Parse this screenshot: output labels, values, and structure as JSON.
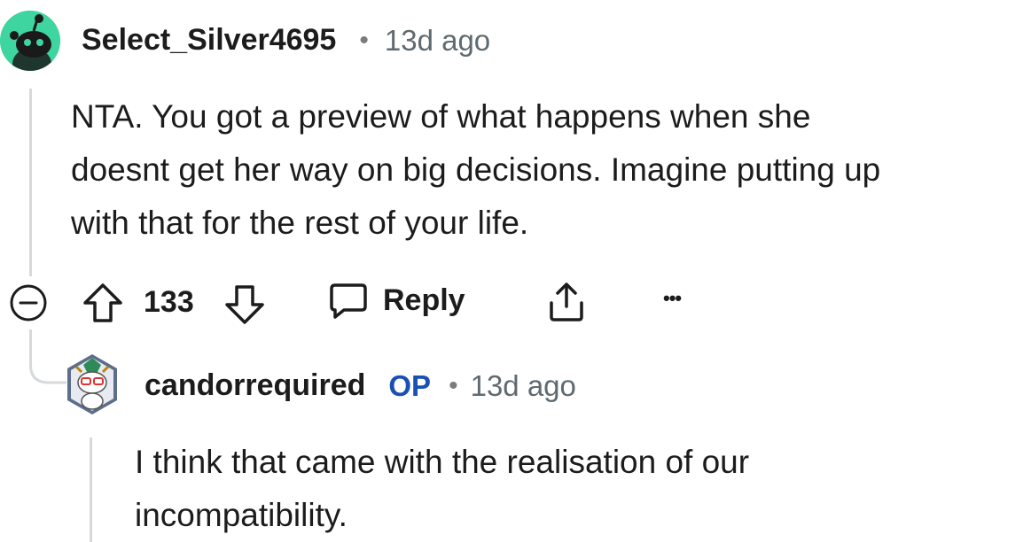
{
  "comment": {
    "author": "Select_Silver4695",
    "separator": "•",
    "time": "13d ago",
    "lines": [
      "NTA. You got a preview of what happens when she",
      "doesnt get her way on big decisions. Imagine putting up",
      "with that for the rest of your life."
    ],
    "avatar_color": "#3ed5a0"
  },
  "actions": {
    "collapse_icon": "collapse-minus-icon",
    "upvote_icon": "upvote-arrow-icon",
    "score": "133",
    "downvote_icon": "downvote-arrow-icon",
    "reply_label": "Reply",
    "share_icon": "share-icon",
    "more_label": "•••"
  },
  "reply": {
    "author": "candorrequired",
    "badge": "OP",
    "separator": "•",
    "time": "13d ago",
    "lines": [
      "I think that came with the realisation of our",
      "incompatibility."
    ],
    "badge_color": "#1a4fb5"
  }
}
